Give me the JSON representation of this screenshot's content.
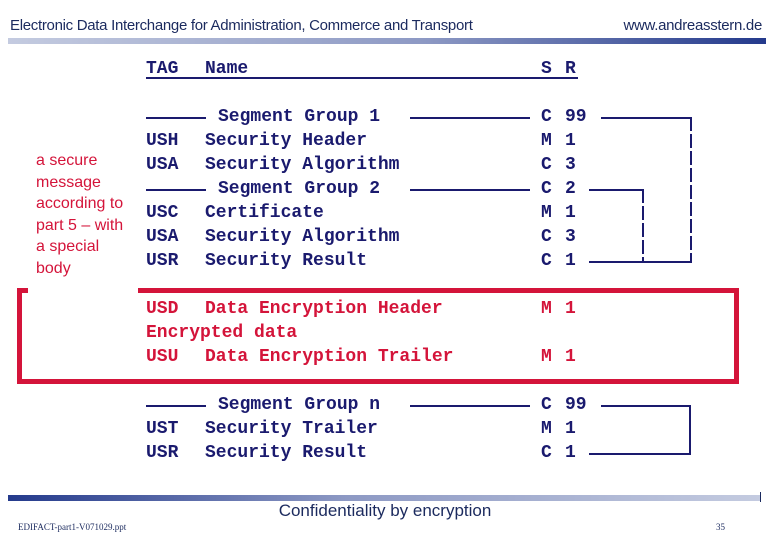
{
  "header": {
    "title": "Electronic Data Interchange for Administration, Commerce and Transport",
    "url": "www.andreasstern.de"
  },
  "table_header": {
    "tag": "TAG",
    "name": "Name",
    "s": "S",
    "r": "R"
  },
  "side_note": "a secure message according to part 5 – with a special body",
  "rows": [
    {
      "type": "group",
      "name": "Segment Group 1",
      "s": "C",
      "r": "99"
    },
    {
      "type": "segment",
      "tag": "USH",
      "name": "Security Header",
      "s": "M",
      "r": "1"
    },
    {
      "type": "segment",
      "tag": "USA",
      "name": "Security Algorithm",
      "s": "C",
      "r": "3"
    },
    {
      "type": "group",
      "name": "Segment Group 2",
      "s": "C",
      "r": "2"
    },
    {
      "type": "segment",
      "tag": "USC",
      "name": "Certificate",
      "s": "M",
      "r": "1"
    },
    {
      "type": "segment",
      "tag": "USA",
      "name": "Security Algorithm",
      "s": "C",
      "r": "3"
    },
    {
      "type": "segment",
      "tag": "USR",
      "name": "Security Result",
      "s": "C",
      "r": "1"
    },
    {
      "type": "segment",
      "tag": "USD",
      "name": "Data Encryption Header",
      "s": "M",
      "r": "1"
    },
    {
      "type": "data",
      "name": "Encrypted data"
    },
    {
      "type": "segment",
      "tag": "USU",
      "name": "Data Encryption Trailer",
      "s": "M",
      "r": "1"
    },
    {
      "type": "group",
      "name": "Segment Group n",
      "s": "C",
      "r": "99"
    },
    {
      "type": "segment",
      "tag": "UST",
      "name": "Security Trailer",
      "s": "M",
      "r": "1"
    },
    {
      "type": "segment",
      "tag": "USR",
      "name": "Security Result",
      "s": "C",
      "r": "1"
    }
  ],
  "footer": {
    "caption": "Confidentiality by encryption",
    "file": "EDIFACT-part1-V071029.ppt",
    "page": "35"
  },
  "colors": {
    "navy": "#1a1a6e",
    "red": "#d4143a"
  }
}
